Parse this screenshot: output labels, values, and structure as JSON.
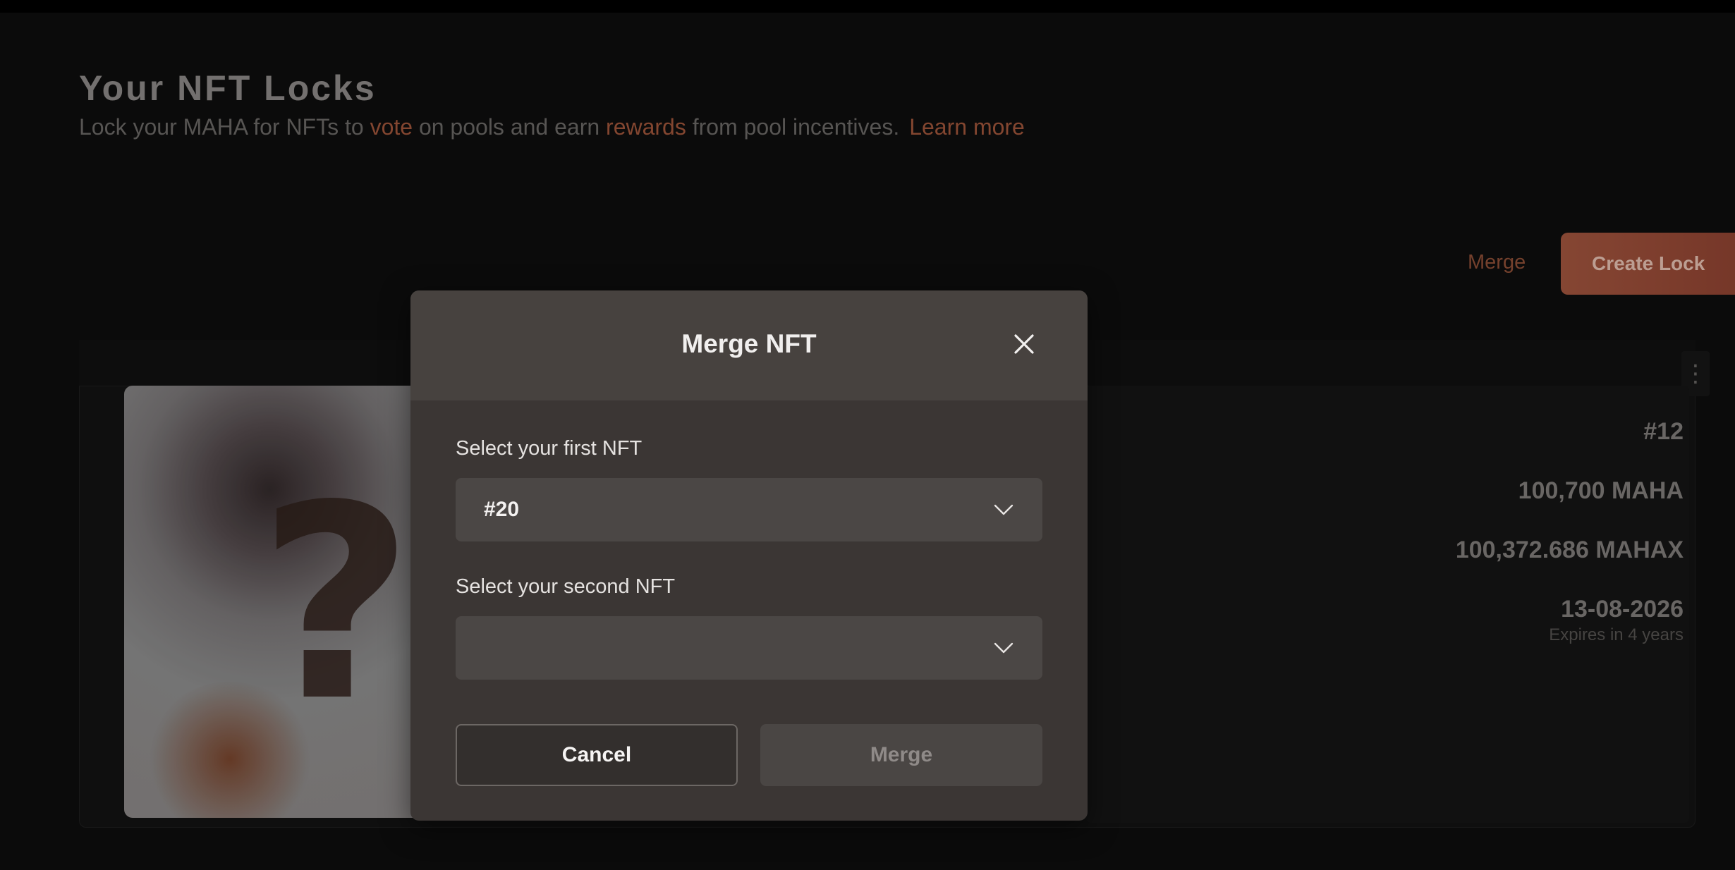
{
  "page": {
    "title": "Your NFT Locks",
    "subtitle": {
      "part1": "Lock your MAHA for NFTs to ",
      "vote": "vote",
      "part2": " on pools and earn ",
      "rewards": "rewards",
      "part3": " from pool incentives.",
      "learn_more": "Learn more"
    },
    "actions": {
      "merge_label": "Merge",
      "create_lock_label": "Create Lock"
    }
  },
  "nft_card": {
    "menu_icon": "more-vertical-icon",
    "image_placeholder": "?",
    "token_id": "#12",
    "locked_amount": "100,700 MAHA",
    "voting_power": "100,372.686 MAHAX",
    "expiry_date": "13-08-2026",
    "expiry_note": "Expires in 4 years"
  },
  "modal": {
    "title": "Merge NFT",
    "close_icon": "close-icon",
    "first_label": "Select your first NFT",
    "first_value": "#20",
    "second_label": "Select your second NFT",
    "second_value": "",
    "chevron_icon": "chevron-down-icon",
    "cancel_label": "Cancel",
    "merge_label": "Merge"
  },
  "colors": {
    "accent": "#8b4a33",
    "modal_bg": "#3b3634",
    "modal_header_bg": "#47423f",
    "page_bg": "#0c0c0c"
  }
}
